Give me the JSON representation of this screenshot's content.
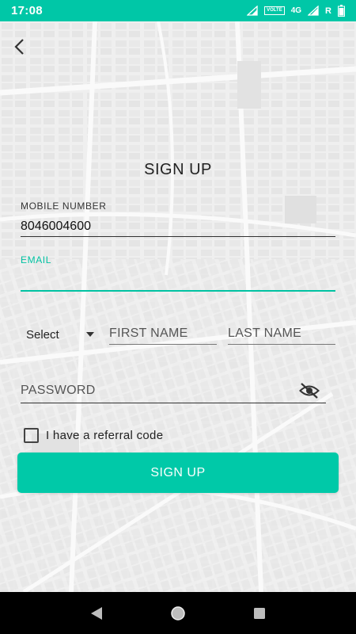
{
  "status_bar": {
    "time": "17:08",
    "volte": "VOLTE",
    "network_type": "4G",
    "roaming": "R",
    "icons": [
      "signal-icon",
      "volte-icon",
      "network-4g-icon",
      "signal-icon",
      "roaming-icon",
      "battery-icon"
    ]
  },
  "colors": {
    "accent": "#00c9a8",
    "status_bar": "#00c7a7",
    "text": "#222222",
    "nav_bar": "#000000"
  },
  "header": {
    "back_icon": "chevron-left-icon",
    "title": "SIGN UP"
  },
  "form": {
    "mobile": {
      "label": "MOBILE  NUMBER",
      "value": "8046004600"
    },
    "email": {
      "label": "EMAIL",
      "value": ""
    },
    "title_select": {
      "selected": "Select"
    },
    "first_name": {
      "placeholder": "FIRST NAME",
      "value": ""
    },
    "last_name": {
      "placeholder": "LAST NAME",
      "value": ""
    },
    "password": {
      "placeholder": "PASSWORD",
      "value": "",
      "toggle_icon": "eye-off-icon"
    },
    "referral": {
      "label": "I have a referral code",
      "checked": false
    },
    "submit_label": "SIGN UP"
  },
  "nav_bar": {
    "icons": [
      "back-triangle-icon",
      "home-circle-icon",
      "recents-square-icon"
    ]
  }
}
